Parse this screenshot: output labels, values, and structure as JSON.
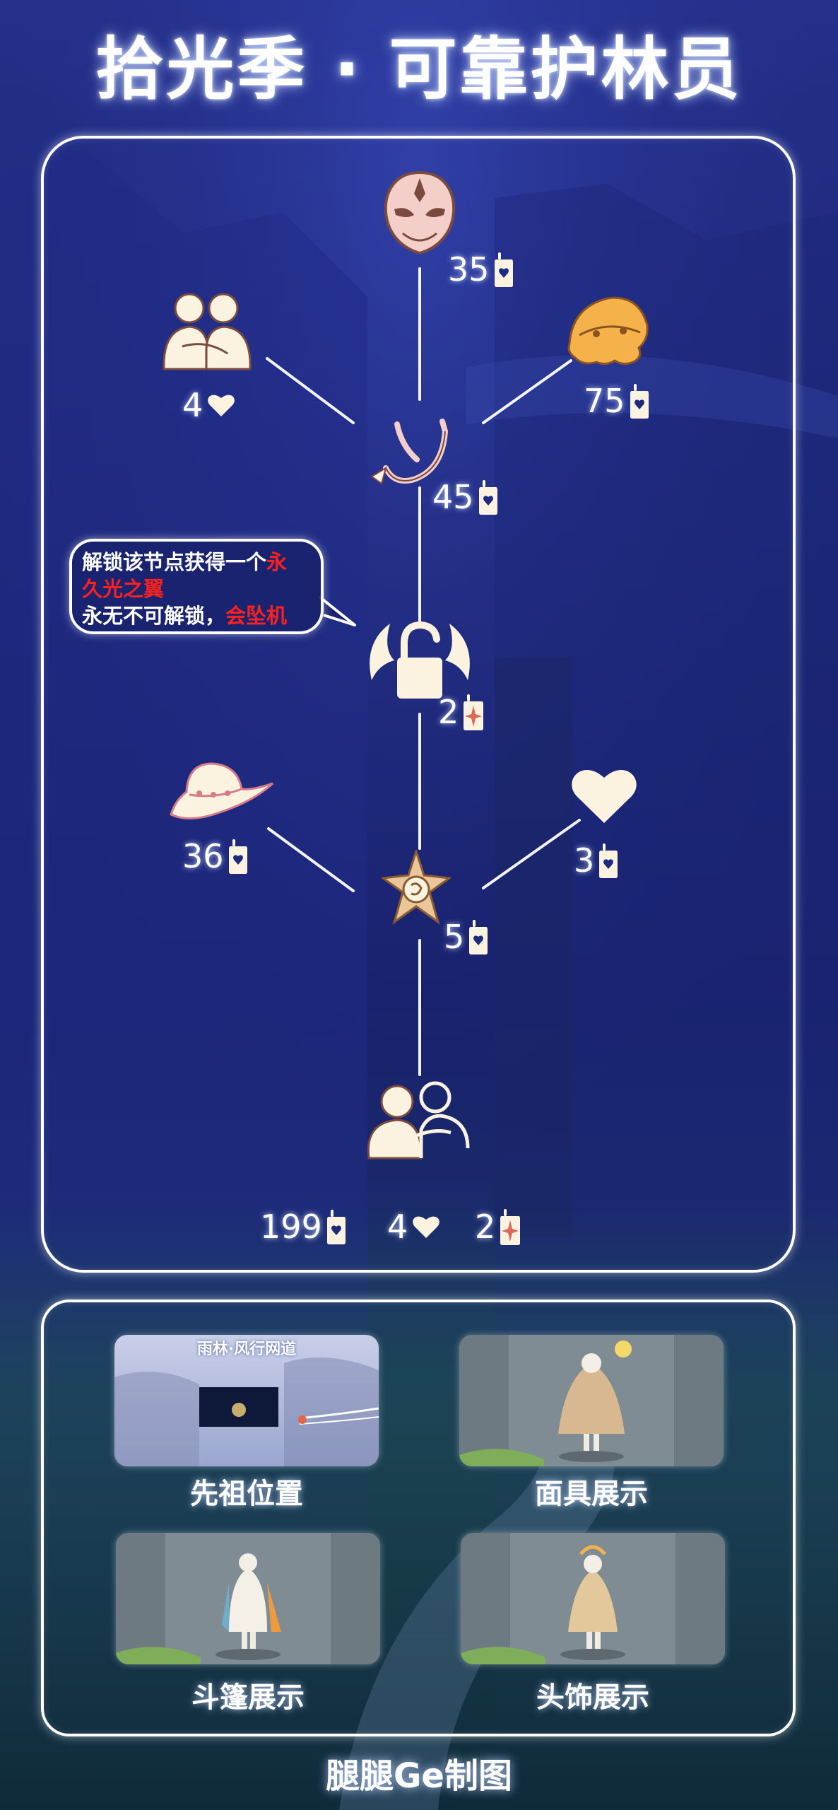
{
  "title": "拾光季 · 可靠护林员",
  "colors": {
    "cream": "#fbf3df",
    "outline": "#7b4a3f",
    "accent_red": "#ff2020",
    "panel_border": "#ffffff",
    "mask_pink": "#f4cfc9",
    "hat_orange": "#f5b24a",
    "cape_tan": "#d8b890"
  },
  "tree": {
    "nodes": [
      {
        "item": "mask-icon",
        "cost": "35",
        "currency": "candle-icon"
      },
      {
        "item": "friend-hug-icon",
        "cost": "4",
        "currency": "heart-icon"
      },
      {
        "item": "orange-hat-icon",
        "cost": "75",
        "currency": "candle-icon"
      },
      {
        "item": "ribbon-icon",
        "cost": "45",
        "currency": "candle-icon"
      },
      {
        "item": "wing-lock-icon",
        "cost": "2",
        "currency": "ascended-candle-icon"
      },
      {
        "item": "wide-brim-hat-icon",
        "cost": "36",
        "currency": "candle-icon"
      },
      {
        "item": "heart-icon",
        "cost": "3",
        "currency": "candle-icon"
      },
      {
        "item": "star-badge-icon",
        "cost": "5",
        "currency": "candle-icon"
      },
      {
        "item": "friend-emote-icon",
        "cost": "",
        "currency": ""
      }
    ],
    "totals": [
      {
        "value": "199",
        "currency": "candle-icon"
      },
      {
        "value": "4",
        "currency": "heart-icon"
      },
      {
        "value": "2",
        "currency": "ascended-candle-icon"
      }
    ],
    "note": {
      "line1": "解锁该节点获得一个",
      "line1_red": "永",
      "line2_red": "久光之翼",
      "line3": "永无不可解锁，",
      "line3_red": "会坠机"
    }
  },
  "gallery": [
    {
      "label": "先祖位置",
      "caption": "雨林·风行网道"
    },
    {
      "label": "面具展示"
    },
    {
      "label": "斗篷展示"
    },
    {
      "label": "头饰展示"
    }
  ],
  "footer": "腿腿Ge制图"
}
